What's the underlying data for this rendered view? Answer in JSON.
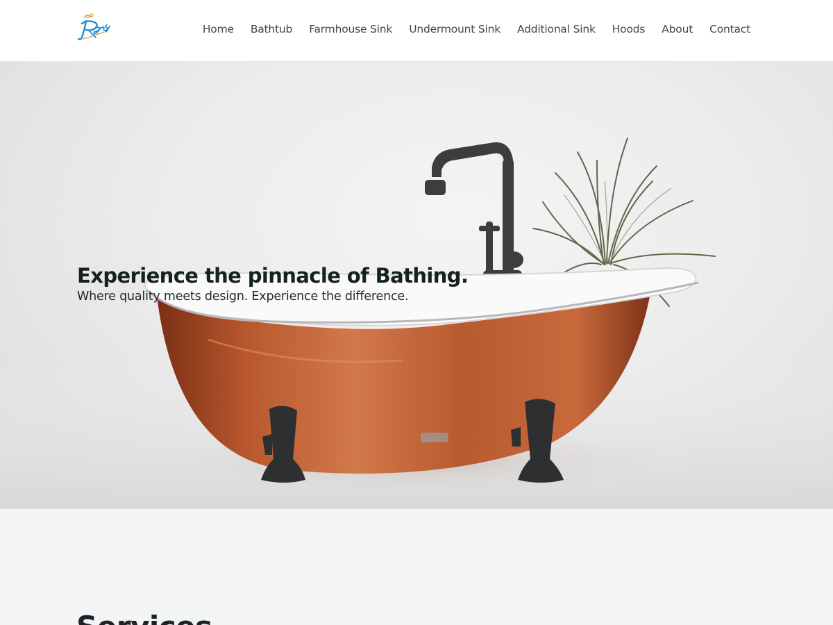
{
  "header": {
    "logo_text": "Rams",
    "nav": [
      {
        "label": "Home"
      },
      {
        "label": "Bathtub"
      },
      {
        "label": "Farmhouse Sink"
      },
      {
        "label": "Undermount Sink"
      },
      {
        "label": "Additional Sink"
      },
      {
        "label": "Hoods"
      },
      {
        "label": "About"
      },
      {
        "label": "Contact"
      }
    ]
  },
  "hero": {
    "title": "Experience the pinnacle of Bathing.",
    "subtitle": "Where quality meets design. Experience the difference.",
    "image_subject": "copper-clawfoot-bathtub-with-faucet-and-plant"
  },
  "services": {
    "title": "Services"
  },
  "colors": {
    "header_bg": "#ffffff",
    "nav_text": "#3f474d",
    "logo_blue": "#1a8fd6",
    "logo_gold": "#d89a3a",
    "copper": "#b8572d",
    "section_bg": "#f3f4f6",
    "hero_title": "#13211f"
  }
}
